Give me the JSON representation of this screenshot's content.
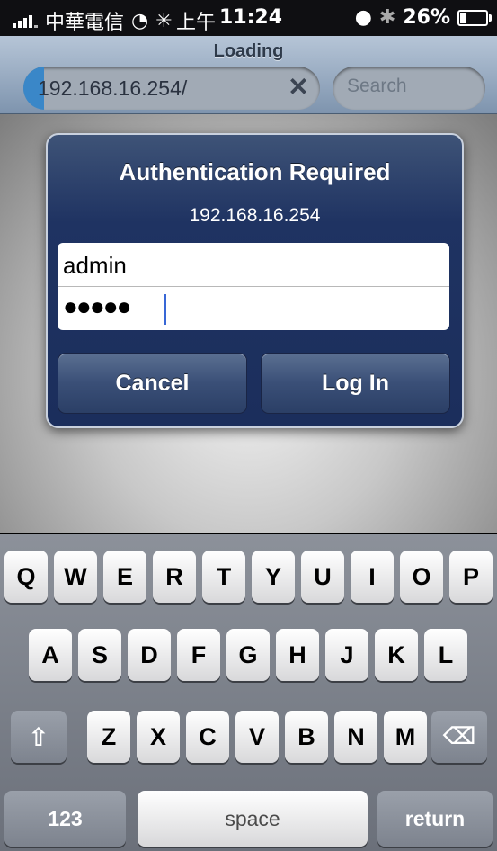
{
  "status_bar": {
    "carrier": "中華電信",
    "time_prefix": "上午",
    "time": "11:24",
    "battery": "26%",
    "battery_level": 0.26
  },
  "browser": {
    "page_status": "Loading",
    "url": "192.168.16.254/",
    "load_progress": 0.07,
    "search_placeholder": "Search"
  },
  "dialog": {
    "title": "Authentication Required",
    "host": "192.168.16.254",
    "username": "admin",
    "password_mask": "●●●●●",
    "cancel_label": "Cancel",
    "login_label": "Log In"
  },
  "keyboard": {
    "row1": [
      "Q",
      "W",
      "E",
      "R",
      "T",
      "Y",
      "U",
      "I",
      "O",
      "P"
    ],
    "row2": [
      "A",
      "S",
      "D",
      "F",
      "G",
      "H",
      "J",
      "K",
      "L"
    ],
    "row3": [
      "Z",
      "X",
      "C",
      "V",
      "B",
      "N",
      "M"
    ],
    "numbers_label": "123",
    "space_label": "space",
    "return_label": "return"
  },
  "colors": {
    "dialog_bg": "#1f3362",
    "progress": "#3a87c8",
    "caret": "#3867d6"
  }
}
